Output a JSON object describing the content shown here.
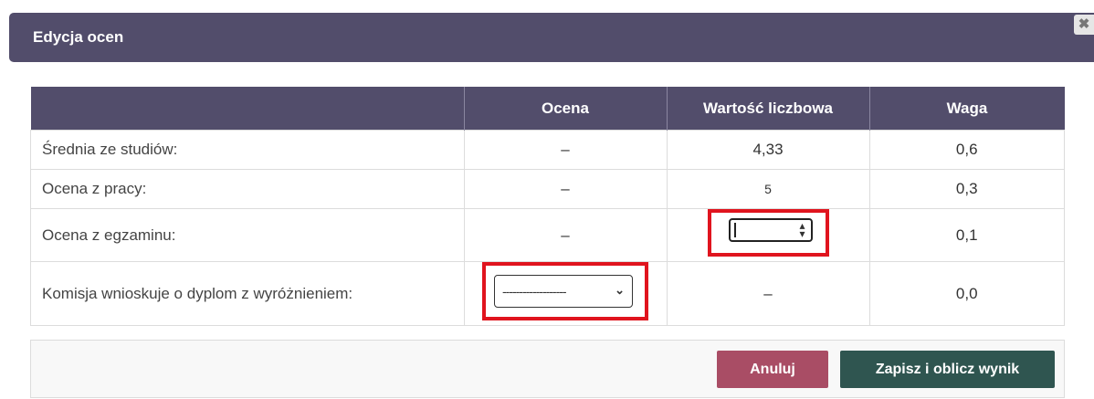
{
  "dialog": {
    "title": "Edycja ocen",
    "close_icon": "close-icon"
  },
  "table": {
    "headers": [
      "",
      "Ocena",
      "Wartość liczbowa",
      "Waga"
    ],
    "rows": [
      {
        "label": "Średnia ze studiów:",
        "ocena": "–",
        "wartosc": "4,33",
        "waga": "0,6"
      },
      {
        "label": "Ocena z pracy:",
        "ocena": "–",
        "wartosc": "5",
        "waga": "0,3"
      },
      {
        "label": "Ocena z egzaminu:",
        "ocena": "–",
        "wartosc": "",
        "waga": "0,1"
      },
      {
        "label": "Komisja wnioskuje o dyplom z wyróżnieniem:",
        "ocena": "-------------------",
        "wartosc": "–",
        "waga": "0,0"
      }
    ]
  },
  "buttons": {
    "cancel": "Anuluj",
    "save": "Zapisz i oblicz wynik"
  },
  "colors": {
    "header": "#524d6b",
    "highlight": "#e0141e",
    "cancel": "#a94d65",
    "save": "#2f5550"
  }
}
